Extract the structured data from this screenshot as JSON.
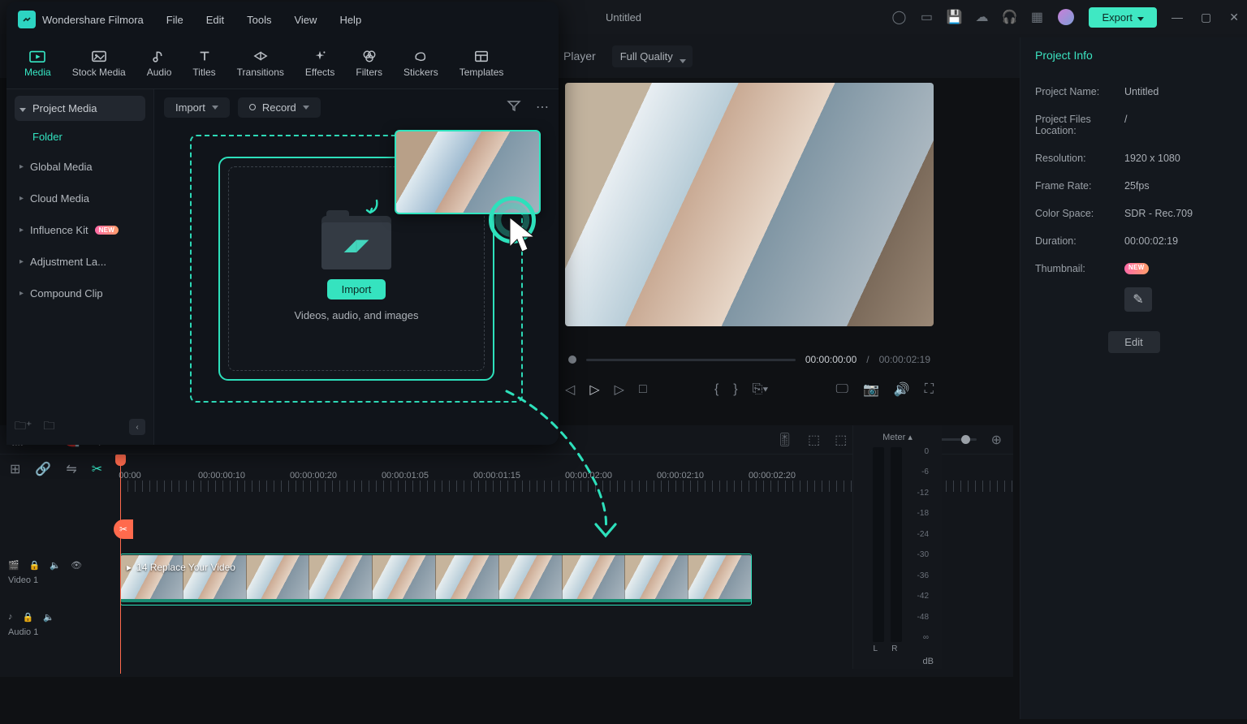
{
  "app": {
    "title": "Wondershare Filmora",
    "document_title": "Untitled",
    "menubar": [
      "File",
      "Edit",
      "Tools",
      "View",
      "Help"
    ],
    "export_label": "Export"
  },
  "tabs": [
    {
      "label": "Media",
      "icon": "media-icon"
    },
    {
      "label": "Stock Media",
      "icon": "stock-icon"
    },
    {
      "label": "Audio",
      "icon": "audio-icon"
    },
    {
      "label": "Titles",
      "icon": "titles-icon"
    },
    {
      "label": "Transitions",
      "icon": "transitions-icon"
    },
    {
      "label": "Effects",
      "icon": "effects-icon"
    },
    {
      "label": "Filters",
      "icon": "filters-icon"
    },
    {
      "label": "Stickers",
      "icon": "stickers-icon"
    },
    {
      "label": "Templates",
      "icon": "templates-icon"
    }
  ],
  "sidebar": {
    "header": "Project Media",
    "folder_label": "Folder",
    "items": [
      {
        "label": "Global Media"
      },
      {
        "label": "Cloud Media"
      },
      {
        "label": "Influence Kit",
        "new": true
      },
      {
        "label": "Adjustment La..."
      },
      {
        "label": "Compound Clip"
      }
    ]
  },
  "content_toolbar": {
    "import": "Import",
    "record": "Record"
  },
  "dropzone": {
    "button": "Import",
    "hint": "Videos, audio, and images"
  },
  "player": {
    "label": "Player",
    "quality": "Full Quality",
    "current": "00:00:00:00",
    "total": "00:00:02:19"
  },
  "info": {
    "title": "Project Info",
    "rows": {
      "project_name": {
        "k": "Project Name:",
        "v": "Untitled"
      },
      "location": {
        "k": "Project Files Location:",
        "v": "/"
      },
      "resolution": {
        "k": "Resolution:",
        "v": "1920 x 1080"
      },
      "frame_rate": {
        "k": "Frame Rate:",
        "v": "25fps"
      },
      "color_space": {
        "k": "Color Space:",
        "v": "SDR - Rec.709"
      },
      "duration": {
        "k": "Duration:",
        "v": "00:00:02:19"
      },
      "thumbnail": {
        "k": "Thumbnail:",
        "v": ""
      }
    },
    "edit_label": "Edit"
  },
  "timeline": {
    "ruler": [
      "00:00",
      "00:00:00:10",
      "00:00:00:20",
      "00:00:01:05",
      "00:00:01:15",
      "00:00:02:00",
      "00:00:02:10",
      "00:00:02:20"
    ],
    "video_track": "Video 1",
    "audio_track": "Audio 1",
    "clip_label": "14 Replace Your Video"
  },
  "meter": {
    "title": "Meter ▴",
    "scale": [
      "0",
      "-6",
      "-12",
      "-18",
      "-24",
      "-30",
      "-36",
      "-42",
      "-48",
      "∞"
    ],
    "l": "L",
    "r": "R",
    "db": "dB"
  }
}
